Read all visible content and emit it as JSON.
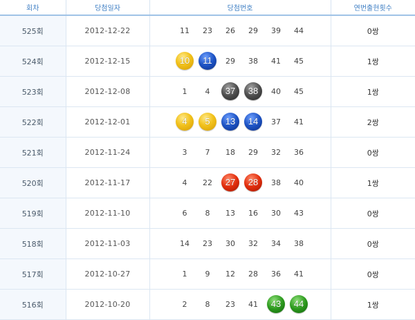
{
  "headers": {
    "round": "회차",
    "date": "당첨일자",
    "numbers": "당첨번호",
    "consecutive": "연번출현횟수"
  },
  "colors": {
    "header_text": "#3f7fc4",
    "yellow_ball": "#f2c21c",
    "blue_ball": "#1d53c4",
    "gray_ball": "#4e4e4e",
    "red_ball": "#e22d0c",
    "green_ball": "#2d9a1e"
  },
  "rows": [
    {
      "round": "525회",
      "date": "2012-12-22",
      "count": "0쌍",
      "nums": [
        {
          "v": "11",
          "c": ""
        },
        {
          "v": "23",
          "c": ""
        },
        {
          "v": "26",
          "c": ""
        },
        {
          "v": "29",
          "c": ""
        },
        {
          "v": "39",
          "c": ""
        },
        {
          "v": "44",
          "c": ""
        }
      ]
    },
    {
      "round": "524회",
      "date": "2012-12-15",
      "count": "1쌍",
      "nums": [
        {
          "v": "10",
          "c": "yellow"
        },
        {
          "v": "11",
          "c": "blue"
        },
        {
          "v": "29",
          "c": ""
        },
        {
          "v": "38",
          "c": ""
        },
        {
          "v": "41",
          "c": ""
        },
        {
          "v": "45",
          "c": ""
        }
      ]
    },
    {
      "round": "523회",
      "date": "2012-12-08",
      "count": "1쌍",
      "nums": [
        {
          "v": "1",
          "c": ""
        },
        {
          "v": "4",
          "c": ""
        },
        {
          "v": "37",
          "c": "gray"
        },
        {
          "v": "38",
          "c": "gray"
        },
        {
          "v": "40",
          "c": ""
        },
        {
          "v": "45",
          "c": ""
        }
      ]
    },
    {
      "round": "522회",
      "date": "2012-12-01",
      "count": "2쌍",
      "nums": [
        {
          "v": "4",
          "c": "yellow"
        },
        {
          "v": "5",
          "c": "yellow"
        },
        {
          "v": "13",
          "c": "blue"
        },
        {
          "v": "14",
          "c": "blue"
        },
        {
          "v": "37",
          "c": ""
        },
        {
          "v": "41",
          "c": ""
        }
      ]
    },
    {
      "round": "521회",
      "date": "2012-11-24",
      "count": "0쌍",
      "nums": [
        {
          "v": "3",
          "c": ""
        },
        {
          "v": "7",
          "c": ""
        },
        {
          "v": "18",
          "c": ""
        },
        {
          "v": "29",
          "c": ""
        },
        {
          "v": "32",
          "c": ""
        },
        {
          "v": "36",
          "c": ""
        }
      ]
    },
    {
      "round": "520회",
      "date": "2012-11-17",
      "count": "1쌍",
      "nums": [
        {
          "v": "4",
          "c": ""
        },
        {
          "v": "22",
          "c": ""
        },
        {
          "v": "27",
          "c": "red"
        },
        {
          "v": "28",
          "c": "red"
        },
        {
          "v": "38",
          "c": ""
        },
        {
          "v": "40",
          "c": ""
        }
      ]
    },
    {
      "round": "519회",
      "date": "2012-11-10",
      "count": "0쌍",
      "nums": [
        {
          "v": "6",
          "c": ""
        },
        {
          "v": "8",
          "c": ""
        },
        {
          "v": "13",
          "c": ""
        },
        {
          "v": "16",
          "c": ""
        },
        {
          "v": "30",
          "c": ""
        },
        {
          "v": "43",
          "c": ""
        }
      ]
    },
    {
      "round": "518회",
      "date": "2012-11-03",
      "count": "0쌍",
      "nums": [
        {
          "v": "14",
          "c": ""
        },
        {
          "v": "23",
          "c": ""
        },
        {
          "v": "30",
          "c": ""
        },
        {
          "v": "32",
          "c": ""
        },
        {
          "v": "34",
          "c": ""
        },
        {
          "v": "38",
          "c": ""
        }
      ]
    },
    {
      "round": "517회",
      "date": "2012-10-27",
      "count": "0쌍",
      "nums": [
        {
          "v": "1",
          "c": ""
        },
        {
          "v": "9",
          "c": ""
        },
        {
          "v": "12",
          "c": ""
        },
        {
          "v": "28",
          "c": ""
        },
        {
          "v": "36",
          "c": ""
        },
        {
          "v": "41",
          "c": ""
        }
      ]
    },
    {
      "round": "516회",
      "date": "2012-10-20",
      "count": "1쌍",
      "nums": [
        {
          "v": "2",
          "c": ""
        },
        {
          "v": "8",
          "c": ""
        },
        {
          "v": "23",
          "c": ""
        },
        {
          "v": "41",
          "c": ""
        },
        {
          "v": "43",
          "c": "green"
        },
        {
          "v": "44",
          "c": "green"
        }
      ]
    }
  ]
}
